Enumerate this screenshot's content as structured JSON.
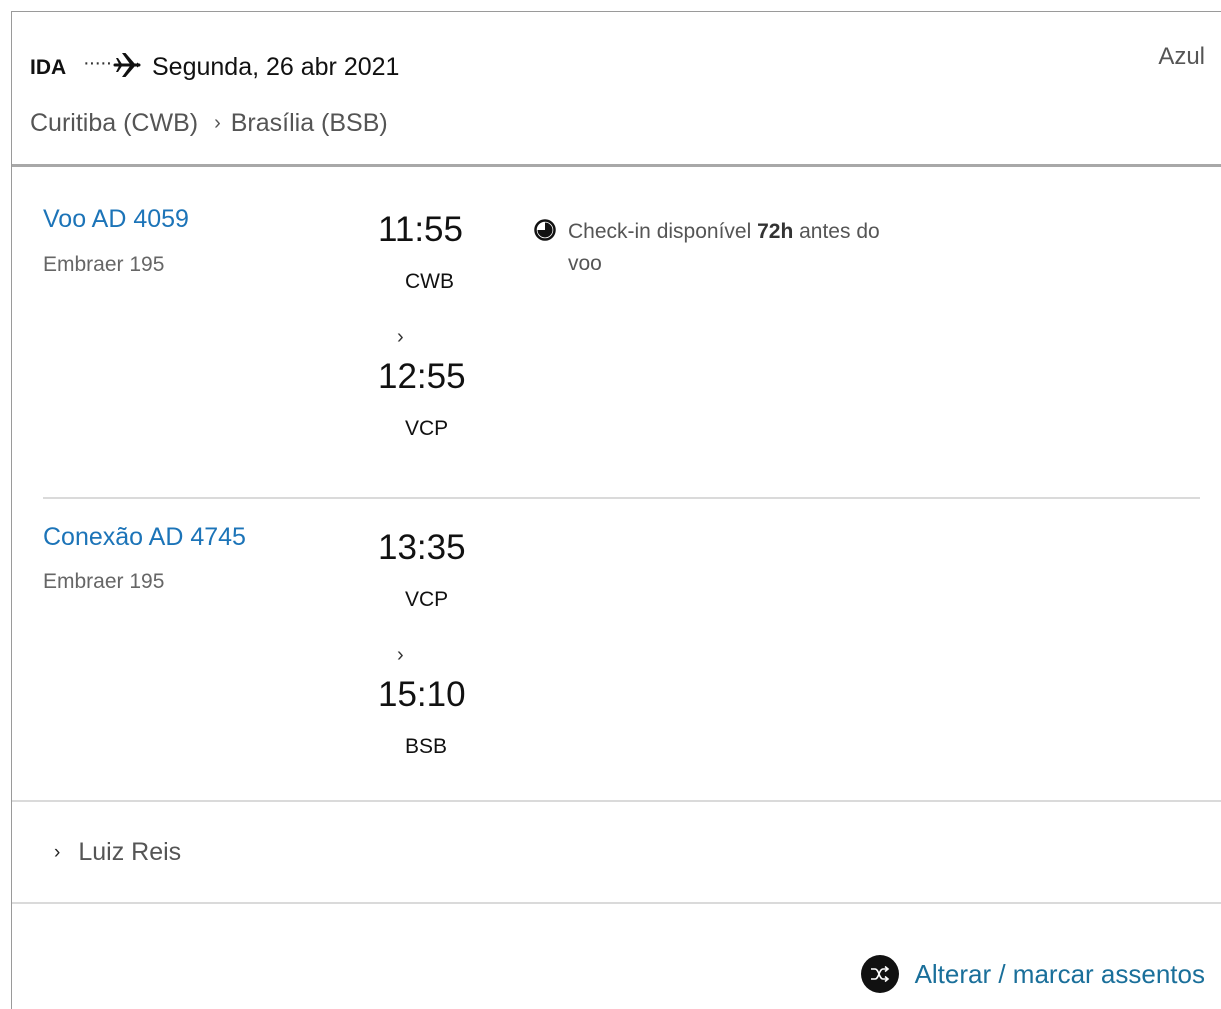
{
  "trip": {
    "direction_label": "IDA",
    "date": "Segunda, 26 abr 2021",
    "airline": "Azul",
    "origin": "Curitiba (CWB)",
    "destination": "Brasília (BSB)"
  },
  "segments": [
    {
      "title": "Voo AD 4059",
      "aircraft": "Embraer 195",
      "departure_time": "11:55",
      "departure_code": "CWB",
      "arrival_time": "12:55",
      "arrival_code": "VCP"
    },
    {
      "title": "Conexão AD 4745",
      "aircraft": "Embraer 195",
      "departure_time": "13:35",
      "departure_code": "VCP",
      "arrival_time": "15:10",
      "arrival_code": "BSB"
    }
  ],
  "checkin": {
    "prefix": "Check-in disponível ",
    "hours": "72h",
    "suffix": " antes do voo"
  },
  "passenger": {
    "name": "Luiz Reis"
  },
  "actions": {
    "seats_label": "Alterar / marcar assentos"
  },
  "icons": {
    "plane": "plane-icon",
    "clock": "clock-icon",
    "shuffle": "shuffle-icon",
    "chevron": "chevron-right-icon"
  },
  "colors": {
    "link_blue": "#1c74b8",
    "seats_blue": "#1a6f9a",
    "divider": "#dadada"
  }
}
